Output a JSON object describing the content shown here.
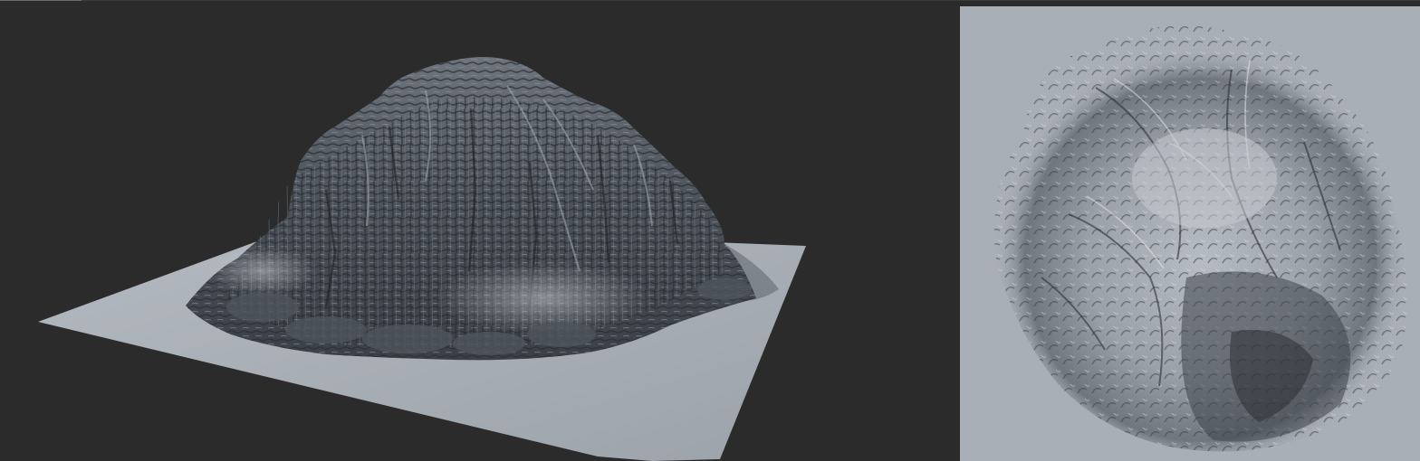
{
  "scene": {
    "background_color": "#2b2b2b",
    "ground_color": "#a9afb6",
    "rock_dark_color": "#2f343a",
    "rock_mid_color": "#5e656d",
    "rock_light_color": "#98a0a9",
    "shadow_color": "#3a4047"
  },
  "panels": [
    {
      "name": "perspective-view",
      "content": "terrain-mountain-3d"
    },
    {
      "name": "top-view",
      "content": "terrain-heightmap-shaded"
    }
  ]
}
